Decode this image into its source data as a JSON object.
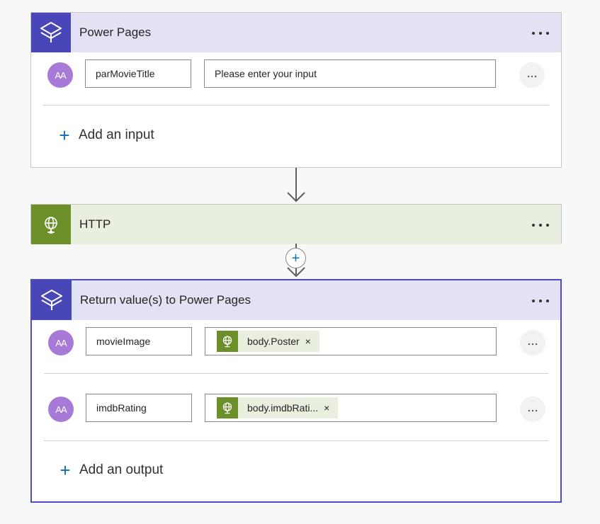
{
  "trigger": {
    "title": "Power Pages",
    "icon": "power-pages-icon",
    "inputs": [
      {
        "avatar": "AA",
        "name": "parMovieTitle",
        "value_placeholder": "Please enter your input"
      }
    ],
    "add_label": "Add an input"
  },
  "http": {
    "title": "HTTP",
    "icon": "globe-icon"
  },
  "return": {
    "title": "Return value(s) to Power Pages",
    "icon": "power-pages-icon",
    "outputs": [
      {
        "avatar": "AA",
        "name": "movieImage",
        "token": "body.Poster",
        "token_icon": "globe-icon"
      },
      {
        "avatar": "AA",
        "name": "imdbRating",
        "token": "body.imdbRati...",
        "token_icon": "globe-icon"
      }
    ],
    "add_label": "Add an output"
  },
  "insert_step": {
    "icon": "plus-icon"
  },
  "colors": {
    "power_pages_accent": "#4946b8",
    "power_pages_header": "#e3e2f5",
    "http_accent": "#6c8f2a",
    "http_header": "#e9efde",
    "avatar": "#a87ad8",
    "link": "#0f6cbd",
    "selected_border": "#4f4bc7"
  }
}
